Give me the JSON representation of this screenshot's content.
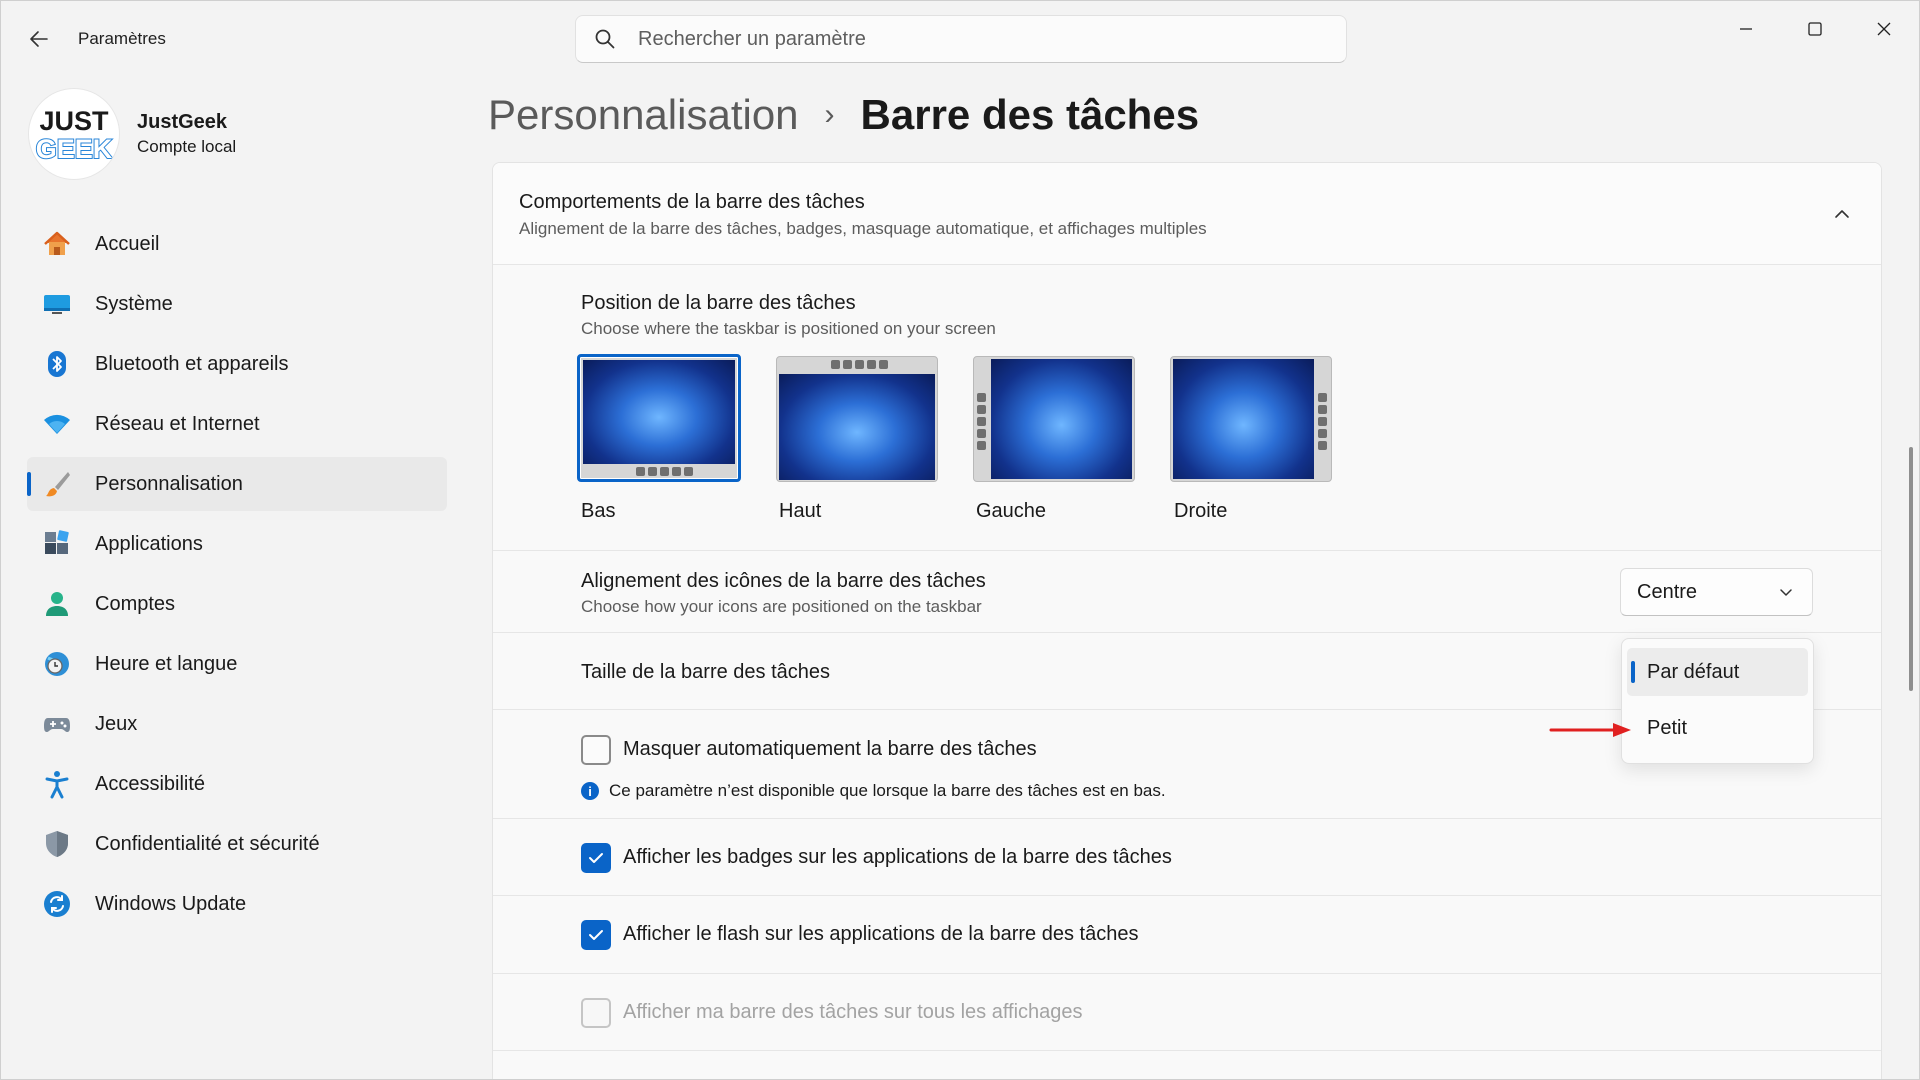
{
  "app": {
    "title": "Paramètres",
    "search_placeholder": "Rechercher un paramètre"
  },
  "profile": {
    "name": "JustGeek",
    "subtitle": "Compte local",
    "avatar_logo_line1": "JUST",
    "avatar_logo_line2": "GEEK"
  },
  "sidebar": {
    "items": [
      {
        "label": "Accueil",
        "icon": "home-icon"
      },
      {
        "label": "Système",
        "icon": "system-icon"
      },
      {
        "label": "Bluetooth et appareils",
        "icon": "bluetooth-icon"
      },
      {
        "label": "Réseau et Internet",
        "icon": "wifi-icon"
      },
      {
        "label": "Personnalisation",
        "icon": "brush-icon",
        "active": true
      },
      {
        "label": "Applications",
        "icon": "apps-icon"
      },
      {
        "label": "Comptes",
        "icon": "account-icon"
      },
      {
        "label": "Heure et langue",
        "icon": "clock-globe-icon"
      },
      {
        "label": "Jeux",
        "icon": "gamepad-icon"
      },
      {
        "label": "Accessibilité",
        "icon": "accessibility-icon"
      },
      {
        "label": "Confidentialité et sécurité",
        "icon": "shield-icon"
      },
      {
        "label": "Windows Update",
        "icon": "update-icon"
      }
    ]
  },
  "breadcrumb": {
    "parent": "Personnalisation",
    "separator": "›",
    "current": "Barre des tâches"
  },
  "behaviors": {
    "title": "Comportements de la barre des tâches",
    "subtitle": "Alignement de la barre des tâches, badges, masquage automatique, et affichages multiples"
  },
  "position": {
    "title": "Position de la barre des tâches",
    "subtitle": "Choose where the taskbar is positioned on your screen",
    "options": [
      {
        "label": "Bas",
        "selected": true
      },
      {
        "label": "Haut",
        "selected": false
      },
      {
        "label": "Gauche",
        "selected": false
      },
      {
        "label": "Droite",
        "selected": false
      }
    ]
  },
  "alignment": {
    "title": "Alignement des icônes de la barre des tâches",
    "subtitle": "Choose how your icons are positioned on the taskbar",
    "value": "Centre"
  },
  "size": {
    "title": "Taille de la barre des tâches",
    "options": [
      "Par défaut",
      "Petit"
    ],
    "selected": "Par défaut"
  },
  "checkboxes": [
    {
      "label": "Masquer automatiquement la barre des tâches",
      "checked": false,
      "disabled": false
    },
    {
      "label": "Afficher les badges sur les applications de la barre des tâches",
      "checked": true,
      "disabled": false
    },
    {
      "label": "Afficher le flash sur les applications de la barre des tâches",
      "checked": true,
      "disabled": false
    },
    {
      "label": "Afficher ma barre des tâches sur tous les affichages",
      "checked": false,
      "disabled": true
    }
  ],
  "info_note": "Ce paramètre n’est disponible que lorsque la barre des tâches est en bas.",
  "colors": {
    "accent": "#0a64c8",
    "annotation_arrow": "#e02020"
  }
}
